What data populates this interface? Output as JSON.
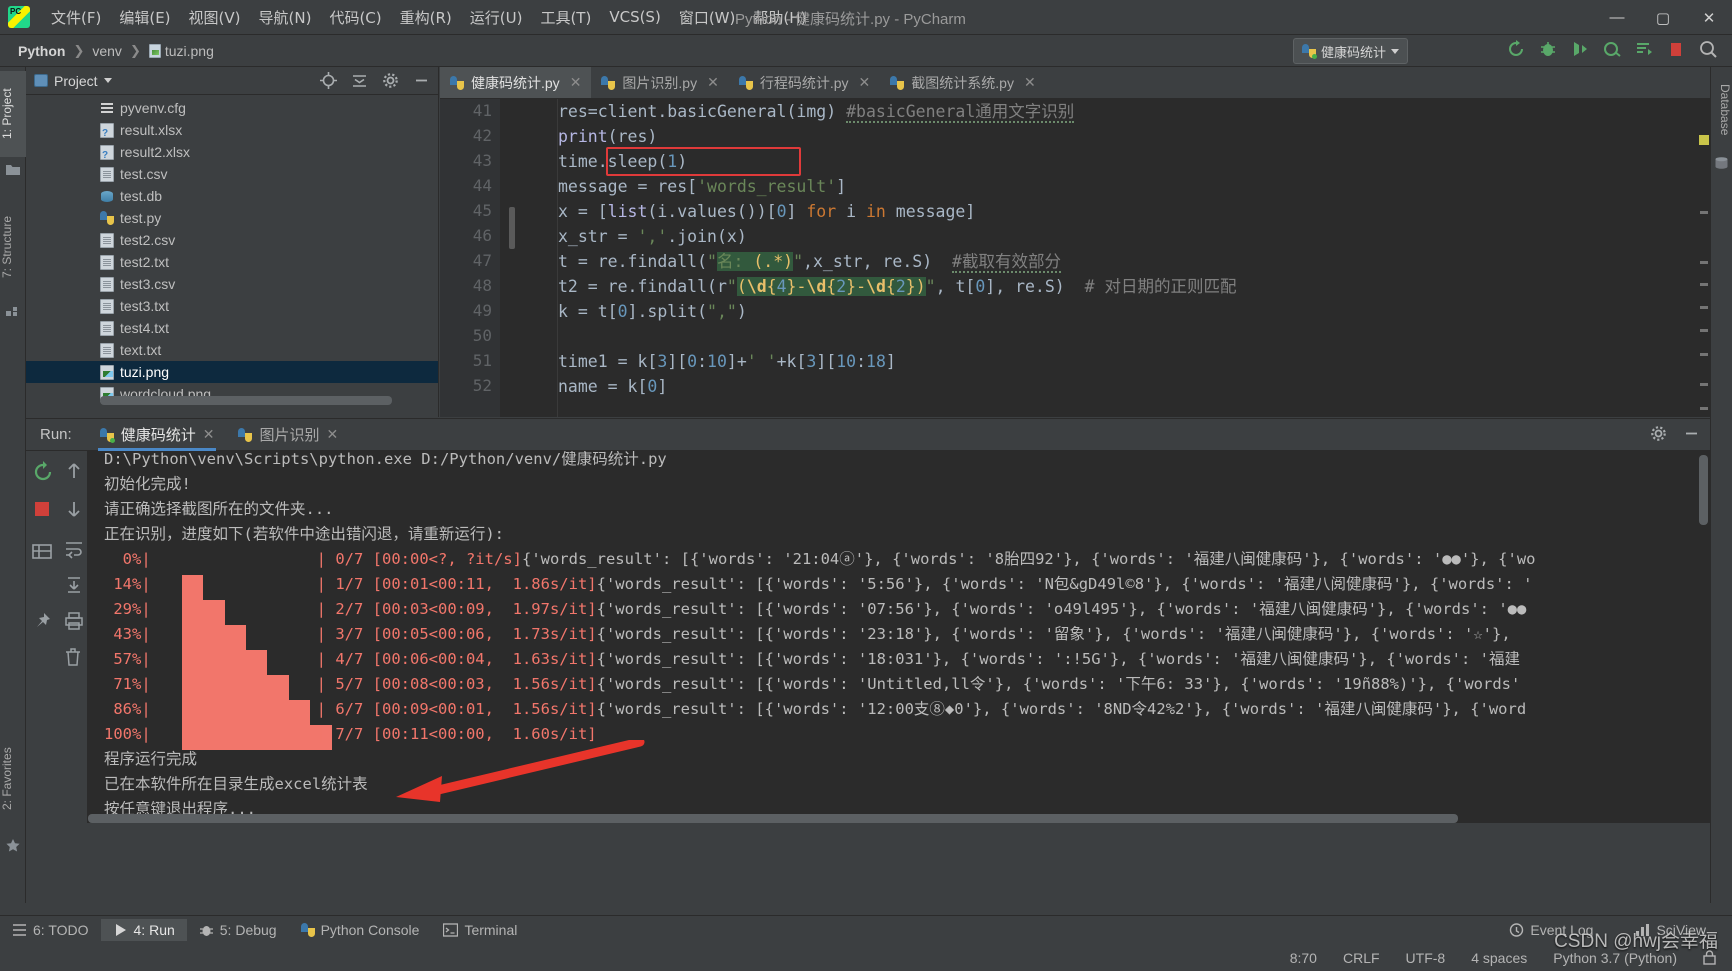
{
  "window": {
    "title": "Python - 健康码统计.py - PyCharm",
    "minimize": "—",
    "maximize": "▢",
    "close": "✕"
  },
  "menu": {
    "items": [
      {
        "label": "文件(F)"
      },
      {
        "label": "编辑(E)"
      },
      {
        "label": "视图(V)"
      },
      {
        "label": "导航(N)"
      },
      {
        "label": "代码(C)"
      },
      {
        "label": "重构(R)"
      },
      {
        "label": "运行(U)"
      },
      {
        "label": "工具(T)"
      },
      {
        "label": "VCS(S)"
      },
      {
        "label": "窗口(W)"
      },
      {
        "label": "帮助(H)"
      }
    ]
  },
  "navbar": {
    "breadcrumbs": [
      "Python",
      "venv",
      "tuzi.png"
    ],
    "separator": "❯",
    "run_config": "健康码统计",
    "toolbar_icons": [
      "rerun-icon",
      "debug-icon",
      "run-with-coverage-icon",
      "profile-icon",
      "run-dashboard-icon",
      "stop-icon",
      "search-everywhere-icon"
    ]
  },
  "left_rail": {
    "items": [
      {
        "label": "1: Project",
        "icon": "project-icon",
        "active": true
      },
      {
        "label": "7: Structure",
        "icon": "structure-icon",
        "active": false
      },
      {
        "label": "2: Favorites",
        "icon": "favorites-icon",
        "active": false
      }
    ]
  },
  "right_rail": {
    "items": [
      {
        "label": "Database",
        "icon": "database-icon"
      },
      {
        "label": "SciView",
        "icon": "sciview-icon"
      }
    ]
  },
  "project": {
    "header_title": "Project",
    "header_icons": [
      "locate-icon",
      "collapse-all-icon",
      "settings-gear-icon",
      "hide-icon"
    ],
    "files": [
      {
        "name": "pyvenv.cfg",
        "icon": "config-file-icon",
        "selected": false
      },
      {
        "name": "result.xlsx",
        "icon": "unknown-file-icon",
        "selected": false
      },
      {
        "name": "result2.xlsx",
        "icon": "unknown-file-icon",
        "selected": false
      },
      {
        "name": "test.csv",
        "icon": "text-file-icon",
        "selected": false
      },
      {
        "name": "test.db",
        "icon": "database-file-icon",
        "selected": false
      },
      {
        "name": "test.py",
        "icon": "python-file-icon",
        "selected": false
      },
      {
        "name": "test2.csv",
        "icon": "text-file-icon",
        "selected": false
      },
      {
        "name": "test2.txt",
        "icon": "text-file-icon",
        "selected": false
      },
      {
        "name": "test3.csv",
        "icon": "text-file-icon",
        "selected": false
      },
      {
        "name": "test3.txt",
        "icon": "text-file-icon",
        "selected": false
      },
      {
        "name": "test4.txt",
        "icon": "text-file-icon",
        "selected": false
      },
      {
        "name": "text.txt",
        "icon": "text-file-icon",
        "selected": false
      },
      {
        "name": "tuzi.png",
        "icon": "image-file-icon",
        "selected": true
      },
      {
        "name": "wordcloud.png",
        "icon": "image-file-icon",
        "selected": false
      }
    ]
  },
  "editor": {
    "tabs": [
      {
        "label": "健康码统计.py",
        "active": true
      },
      {
        "label": "图片识别.py",
        "active": false
      },
      {
        "label": "行程码统计.py",
        "active": false
      },
      {
        "label": "截图统计系统.py",
        "active": false
      }
    ],
    "close_glyph": "✕",
    "line_numbers": [
      "41",
      "42",
      "43",
      "44",
      "45",
      "46",
      "47",
      "48",
      "49",
      "50",
      "51",
      "52"
    ],
    "lines": [
      "res=client.basicGeneral(img) #basicGeneral通用文字识别",
      "print(res)",
      "time.sleep(1)",
      "message = res['words_result']",
      "x = [list(i.values())[0] for i in message]",
      "x_str = ','.join(x)",
      "t = re.findall(\"名: (.*)\",x_str, re.S)  #截取有效部分",
      "t2 = re.findall(r\"(\\d{4}-\\d{2}-\\d{2})\", t[0], re.S)  # 对日期的正则匹配",
      "k = t[0].split(\",\")",
      "",
      "time1 = k[3][0:10]+' '+k[3][10:18]",
      "name = k[0]"
    ],
    "highlight_box_line": "time.sleep(1)"
  },
  "run": {
    "label": "Run:",
    "tabs": [
      {
        "label": "健康码统计",
        "active": true
      },
      {
        "label": "图片识别",
        "active": false
      }
    ],
    "close_glyph": "✕",
    "sidebar_buttons": [
      "rerun-icon",
      "scroll-up-icon",
      "stop-icon",
      "scroll-down-icon",
      "print-layout-icon",
      "soft-wrap-icon",
      "scroll-to-end-icon",
      "pin-icon",
      "print-icon",
      "trash-icon"
    ],
    "header_buttons": [
      "settings-gear-icon",
      "hide-panel-icon"
    ],
    "console": {
      "command": "D:\\Python\\venv\\Scripts\\python.exe D:/Python/venv/健康码统计.py",
      "messages_top": [
        "初始化完成!",
        "请正确选择截图所在的文件夹...",
        "正在识别，进度如下(若软件中途出错闪退，请重新运行):"
      ],
      "progress_lines": [
        {
          "pct": "  0%|",
          "mid": "| 0/7 [00:00<?, ?it/s]",
          "tail": "{'words_result': [{'words': '21:04ⓐ'}, {'words': '8胎四92'}, {'words': '福建八闽健康码'}, {'words': '●●'}, {'wo",
          "fill": 0
        },
        {
          "pct": " 14%|",
          "mid": "| 1/7 [00:01<00:11,  1.86s/it]",
          "tail": "{'words_result': [{'words': '5:56'}, {'words': 'N包&gD49l©8'}, {'words': '福建八阅健康码'}, {'words': '",
          "fill": 14
        },
        {
          "pct": " 29%|",
          "mid": "| 2/7 [00:03<00:09,  1.97s/it]",
          "tail": "{'words_result': [{'words': '07:56'}, {'words': 'o49l495'}, {'words': '福建八闽健康码'}, {'words': '●●",
          "fill": 29
        },
        {
          "pct": " 43%|",
          "mid": "| 3/7 [00:05<00:06,  1.73s/it]",
          "tail": "{'words_result': [{'words': '23:18'}, {'words': '留象'}, {'words': '福建八闽健康码'}, {'words': '☆'},",
          "fill": 43
        },
        {
          "pct": " 57%|",
          "mid": "| 4/7 [00:06<00:04,  1.63s/it]",
          "tail": "{'words_result': [{'words': '18:031'}, {'words': ':!5G'}, {'words': '福建八闽健康码'}, {'words': '福建",
          "fill": 57
        },
        {
          "pct": " 71%|",
          "mid": "| 5/7 [00:08<00:03,  1.56s/it]",
          "tail": "{'words_result': [{'words': 'Untitled,ll令'}, {'words': '下午6: 33'}, {'words': '19ñ88%)'}, {'words'",
          "fill": 71
        },
        {
          "pct": " 86%|",
          "mid": "| 6/7 [00:09<00:01,  1.56s/it]",
          "tail": "{'words_result': [{'words': '12:00支⑧◆0'}, {'words': '8ND令42%2'}, {'words': '福建八闽健康码'}, {'word",
          "fill": 86
        },
        {
          "pct": "100%|",
          "mid": "| 7/7 [00:11<00:00,  1.60s/it]",
          "tail": "",
          "fill": 100
        }
      ],
      "messages_bottom": [
        "程序运行完成",
        "已在本软件所在目录生成excel统计表",
        "按任意键退出程序..."
      ]
    }
  },
  "bottom_bar": {
    "items": [
      {
        "label": "6: TODO",
        "icon": "todo-icon",
        "active": false
      },
      {
        "label": "4: Run",
        "icon": "run-play-icon",
        "active": true
      },
      {
        "label": "5: Debug",
        "icon": "debug-bug-icon",
        "active": false
      },
      {
        "label": "Python Console",
        "icon": "python-console-icon",
        "active": false
      },
      {
        "label": "Terminal",
        "icon": "terminal-icon",
        "active": false
      }
    ],
    "right_items": [
      {
        "label": "Event Log",
        "icon": "event-log-icon"
      },
      {
        "label": "SciView",
        "icon": "sciview-icon"
      }
    ]
  },
  "status_bar": {
    "caret": "8:70",
    "line_sep": "CRLF",
    "encoding": "UTF-8",
    "indent": "4 spaces",
    "interpreter": "Python 3.7 (Python)",
    "lock_icon": "lock-icon"
  },
  "watermark": "CSDN @hwj会幸福",
  "colors": {
    "accent": "#4a88c7",
    "progress": "#f2766b",
    "annotation": "#e8342a",
    "selection": "#0d293e"
  }
}
